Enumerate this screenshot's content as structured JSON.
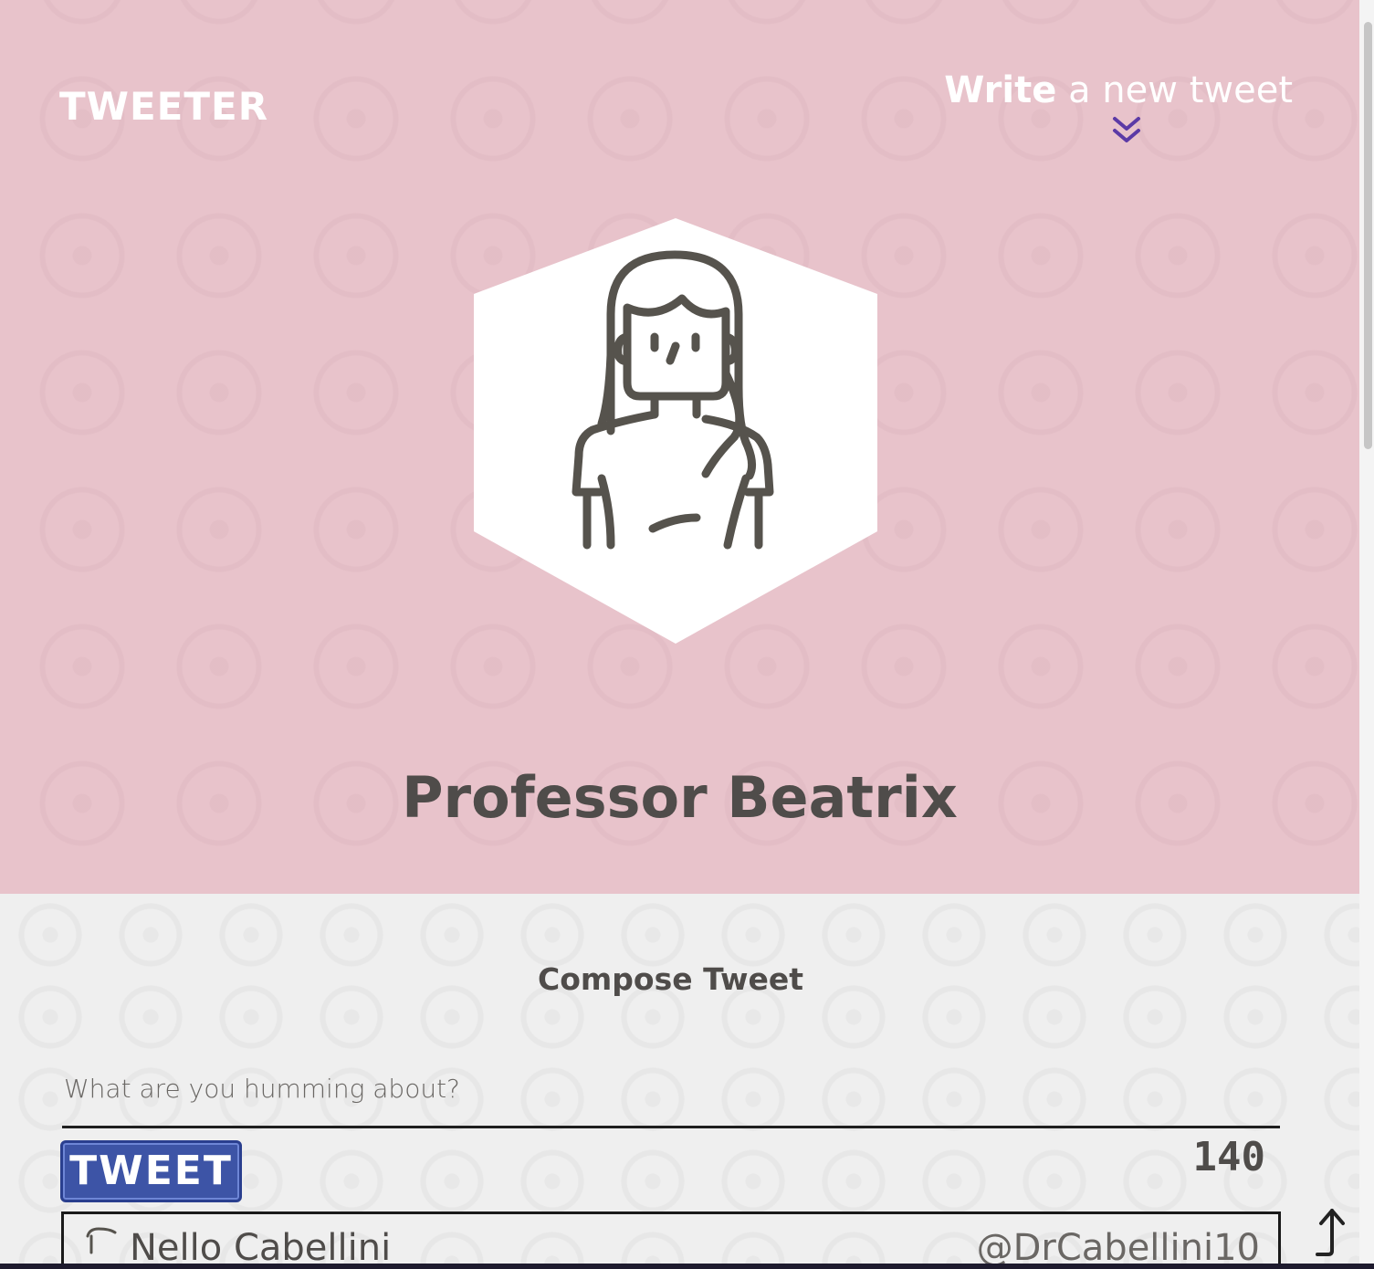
{
  "header": {
    "logo_text": "TWEETER",
    "write_link": {
      "strong": "Write",
      "rest": "a new tweet"
    },
    "chevron_icon": "double-chevron-down-icon",
    "chevron_color": "#5b3aa6"
  },
  "profile": {
    "name": "Professor Beatrix",
    "avatar_icon": "woman-avatar-icon"
  },
  "compose": {
    "title": "Compose Tweet",
    "placeholder": "What are you humming about?",
    "tweet_button_label": "TWEET",
    "char_counter": "140"
  },
  "tweets": [
    {
      "name": "Nello Cabellini",
      "handle": "@DrCabellini10"
    }
  ],
  "colors": {
    "hero_bg": "#e8c3cb",
    "button_bg": "#3d54a6",
    "text_dark": "#4f4c4a"
  },
  "scroll_top_icon": "arrow-up-icon"
}
